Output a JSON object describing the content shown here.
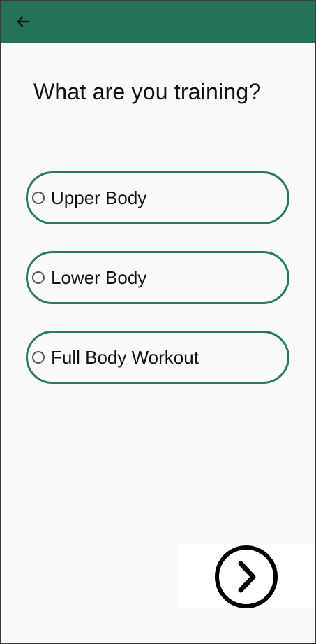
{
  "header": {
    "back_icon": "arrow-left-icon",
    "color": "#24725a"
  },
  "main": {
    "question": "What are you training?",
    "options": [
      {
        "label": "Upper Body",
        "selected": false
      },
      {
        "label": "Lower Body",
        "selected": false
      },
      {
        "label": "Full Body Workout",
        "selected": false
      }
    ],
    "next_icon": "chevron-right-circle-icon"
  }
}
